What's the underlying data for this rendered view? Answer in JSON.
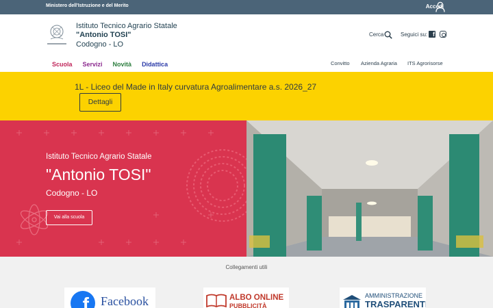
{
  "topbar": {
    "ministry": "Ministero dell'Istruzione e del Merito",
    "login": "Accedi"
  },
  "header": {
    "school_line1": "Istituto Tecnico Agrario Statale",
    "school_line2": "\"Antonio TOSI\"",
    "school_line3": "Codogno - LO",
    "search_label": "Cerca",
    "follow_label": "Seguici su:"
  },
  "nav": {
    "main": [
      "Scuola",
      "Servizi",
      "Novità",
      "Didattica"
    ],
    "secondary": [
      "Convitto",
      "Azienda Agraria",
      "ITS Agrorisorse"
    ]
  },
  "alert": {
    "text": "1L - Liceo del Made in Italy curvatura Agroalimentare a.s. 2026_27",
    "button": "Dettagli"
  },
  "hero": {
    "line1": "Istituto Tecnico Agrario Statale",
    "line2": "\"Antonio TOSI\"",
    "line3": "Codogno - LO",
    "button": "Vai alla scuola"
  },
  "links": {
    "title": "Collegamenti utili",
    "facebook": "Facebook",
    "albo_line1": "ALBO ONLINE",
    "albo_line2": "PUBBLICITÀ LEGALE",
    "amm_line1": "AMMINISTRAZIONE",
    "amm_line2": "TRASPARENTE"
  },
  "colors": {
    "topbar": "#4b6478",
    "alert": "#fcd200",
    "hero": "#d9344f"
  }
}
